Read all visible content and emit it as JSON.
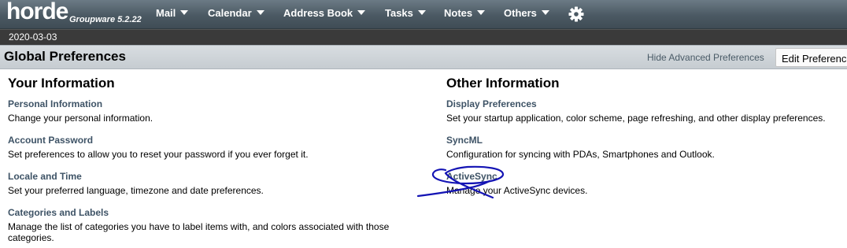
{
  "logo": {
    "word": "horde",
    "product": "Groupware 5.2.22"
  },
  "menu": [
    {
      "label": "Mail"
    },
    {
      "label": "Calendar"
    },
    {
      "label": "Address Book"
    },
    {
      "label": "Tasks"
    },
    {
      "label": "Notes"
    },
    {
      "label": "Others"
    }
  ],
  "date": "2020-03-03",
  "prefs": {
    "title": "Global Preferences",
    "hide_advanced": "Hide Advanced Preferences",
    "edit_button": "Edit Preferences"
  },
  "left_column": {
    "title": "Your Information",
    "items": [
      {
        "link": "Personal Information",
        "desc": "Change your personal information."
      },
      {
        "link": "Account Password",
        "desc": "Set preferences to allow you to reset your password if you ever forget it."
      },
      {
        "link": "Locale and Time",
        "desc": "Set your preferred language, timezone and date preferences."
      },
      {
        "link": "Categories and Labels",
        "desc": "Manage the list of categories you have to label items with, and colors associated with those categories."
      }
    ]
  },
  "right_column": {
    "title": "Other Information",
    "items": [
      {
        "link": "Display Preferences",
        "desc": "Set your startup application, color scheme, page refreshing, and other display preferences."
      },
      {
        "link": "SyncML",
        "desc": "Configuration for syncing with PDAs, Smartphones and Outlook."
      },
      {
        "link": "ActiveSync",
        "desc": "Manage your ActiveSync devices."
      }
    ]
  },
  "colors": {
    "topbar": "#4b5963",
    "link": "#3e5366",
    "annotation": "#1414b4"
  }
}
